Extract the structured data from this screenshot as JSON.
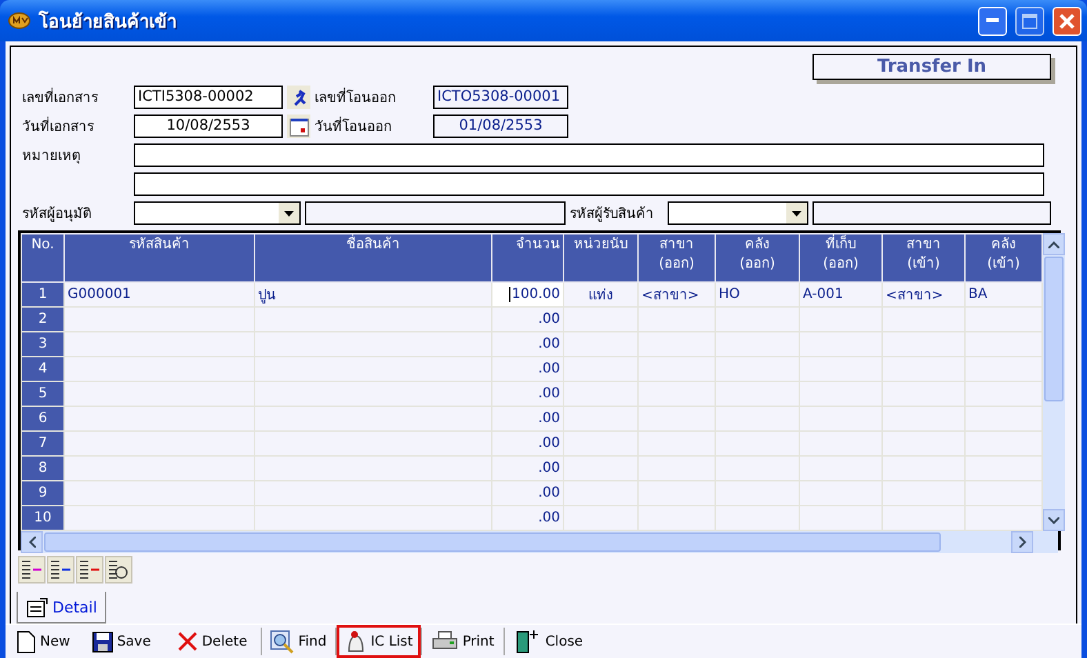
{
  "window": {
    "title": "โอนย้ายสินค้าเข้า"
  },
  "badge": "Transfer In",
  "form": {
    "doc_no_label": "เลขที่เอกสาร",
    "doc_no": "ICTI5308-00002",
    "transfer_out_no_label": "เลขที่โอนออก",
    "transfer_out_no": "ICTO5308-00001",
    "doc_date_label": "วันที่เอกสาร",
    "doc_date": "10/08/2553",
    "transfer_out_date_label": "วันที่โอนออก",
    "transfer_out_date": "01/08/2553",
    "remark_label": "หมายเหตุ",
    "approver_label": "รหัสผู้อนุมัติ",
    "receiver_label": "รหัสผู้รับสินค้า"
  },
  "table": {
    "columns": [
      "No.",
      "รหัสสินค้า",
      "ชื่อสินค้า",
      "จำนวน",
      "หน่วยนับ",
      "สาขา (ออก)",
      "คลัง (ออก)",
      "ที่เก็บ (ออก)",
      "สาขา (เข้า)",
      "คลัง (เข้า)"
    ],
    "rows": [
      {
        "cells": [
          "1",
          "G000001",
          "ปูน",
          "100.00",
          "แท่ง",
          "<สาขา>",
          "HO",
          "A-001",
          "<สาขา>",
          "BA"
        ],
        "editing": true
      },
      {
        "cells": [
          "2",
          "",
          "",
          ".00",
          "",
          "",
          "",
          "",
          "",
          ""
        ],
        "editing": false
      },
      {
        "cells": [
          "3",
          "",
          "",
          ".00",
          "",
          "",
          "",
          "",
          "",
          ""
        ],
        "editing": false
      },
      {
        "cells": [
          "4",
          "",
          "",
          ".00",
          "",
          "",
          "",
          "",
          "",
          ""
        ],
        "editing": false
      },
      {
        "cells": [
          "5",
          "",
          "",
          ".00",
          "",
          "",
          "",
          "",
          "",
          ""
        ],
        "editing": false
      },
      {
        "cells": [
          "6",
          "",
          "",
          ".00",
          "",
          "",
          "",
          "",
          "",
          ""
        ],
        "editing": false
      },
      {
        "cells": [
          "7",
          "",
          "",
          ".00",
          "",
          "",
          "",
          "",
          "",
          ""
        ],
        "editing": false
      },
      {
        "cells": [
          "8",
          "",
          "",
          ".00",
          "",
          "",
          "",
          "",
          "",
          ""
        ],
        "editing": false
      },
      {
        "cells": [
          "9",
          "",
          "",
          ".00",
          "",
          "",
          "",
          "",
          "",
          ""
        ],
        "editing": false
      },
      {
        "cells": [
          "10",
          "",
          "",
          ".00",
          "",
          "",
          "",
          "",
          "",
          ""
        ],
        "editing": false
      }
    ]
  },
  "tabs": [
    {
      "label": "Detail",
      "selected": true
    }
  ],
  "toolbar": [
    {
      "kind": "new",
      "label": "New",
      "highlighted": false
    },
    {
      "kind": "save",
      "label": "Save",
      "highlighted": false
    },
    {
      "kind": "delete",
      "label": "Delete",
      "highlighted": false
    },
    {
      "kind": "find",
      "label": "Find",
      "highlighted": false
    },
    {
      "kind": "list",
      "label": "IC List",
      "highlighted": true
    },
    {
      "kind": "print",
      "label": "Print",
      "highlighted": false
    },
    {
      "kind": "close",
      "label": "Close",
      "highlighted": false
    }
  ]
}
